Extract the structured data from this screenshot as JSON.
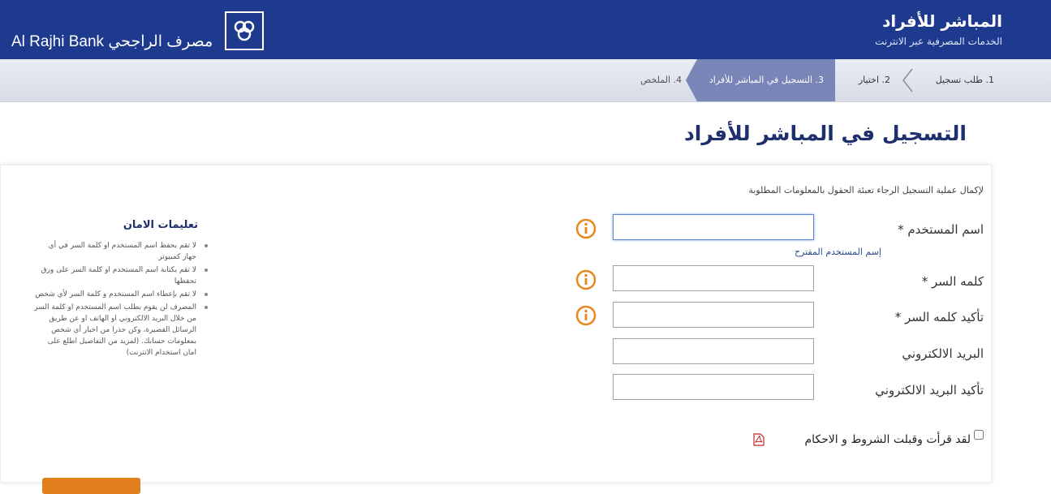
{
  "header": {
    "logo_text": "Al Rajhi Bank مصرف الراجحي",
    "title": "المباشر للأفراد",
    "subtitle": "الخدمات المصرفية عبر الانترنت"
  },
  "steps": [
    {
      "label": "1. طلب تسجيل"
    },
    {
      "label": "2. اختيار"
    },
    {
      "label": "3. التسجيل في المباشر للأفراد"
    },
    {
      "label": "4. الملخص"
    }
  ],
  "page_title": "التسجيل في المباشر للأفراد",
  "form": {
    "intro": "لإكمال عملية التسجيل الرجاء تعبئة الحقول بالمعلومات المطلوبة",
    "username_label": "اسم المستخدم *",
    "username_value": "",
    "suggested_link": "إسم المستخدم المقترح",
    "password_label": "كلمه السر *",
    "password_value": "",
    "confirm_password_label": "تأكيد كلمه السر *",
    "confirm_password_value": "",
    "email_label": "البريد الالكتروني",
    "email_value": "",
    "confirm_email_label": "تأكيد البريد الالكتروني",
    "confirm_email_value": "",
    "terms_label": "لقد قرأت وقبلت الشروط و الاحكام",
    "terms_checked": false
  },
  "security": {
    "title": "تعليمات الامان",
    "tips": [
      "لا تقم بحفظ اسم المستخدم او كلمة السر في أي جهاز كمبيوتر",
      "لا تقم بكتابة اسم المستخدم او كلمة السر على ورق تحفظها",
      "لا تقم بإعطاء اسم المستخدم و كلمة السر لأي شخص",
      "المصرف لن يقوم بطلب اسم المستخدم او كلمة السر من خلال البريد الالكتروني او الهاتف او عن طريق الرسائل القصيرة، وكن حذرا من اخبار أي شخص بمعلومات حسابك. (لمزيد من التفاصيل اطلع على امان استخدام الانترنت)"
    ]
  },
  "colors": {
    "header_bg": "#1d3a8f",
    "active_step_bg": "#7b86b8",
    "info_icon": "#e8871e",
    "button": "#e07f1c"
  }
}
